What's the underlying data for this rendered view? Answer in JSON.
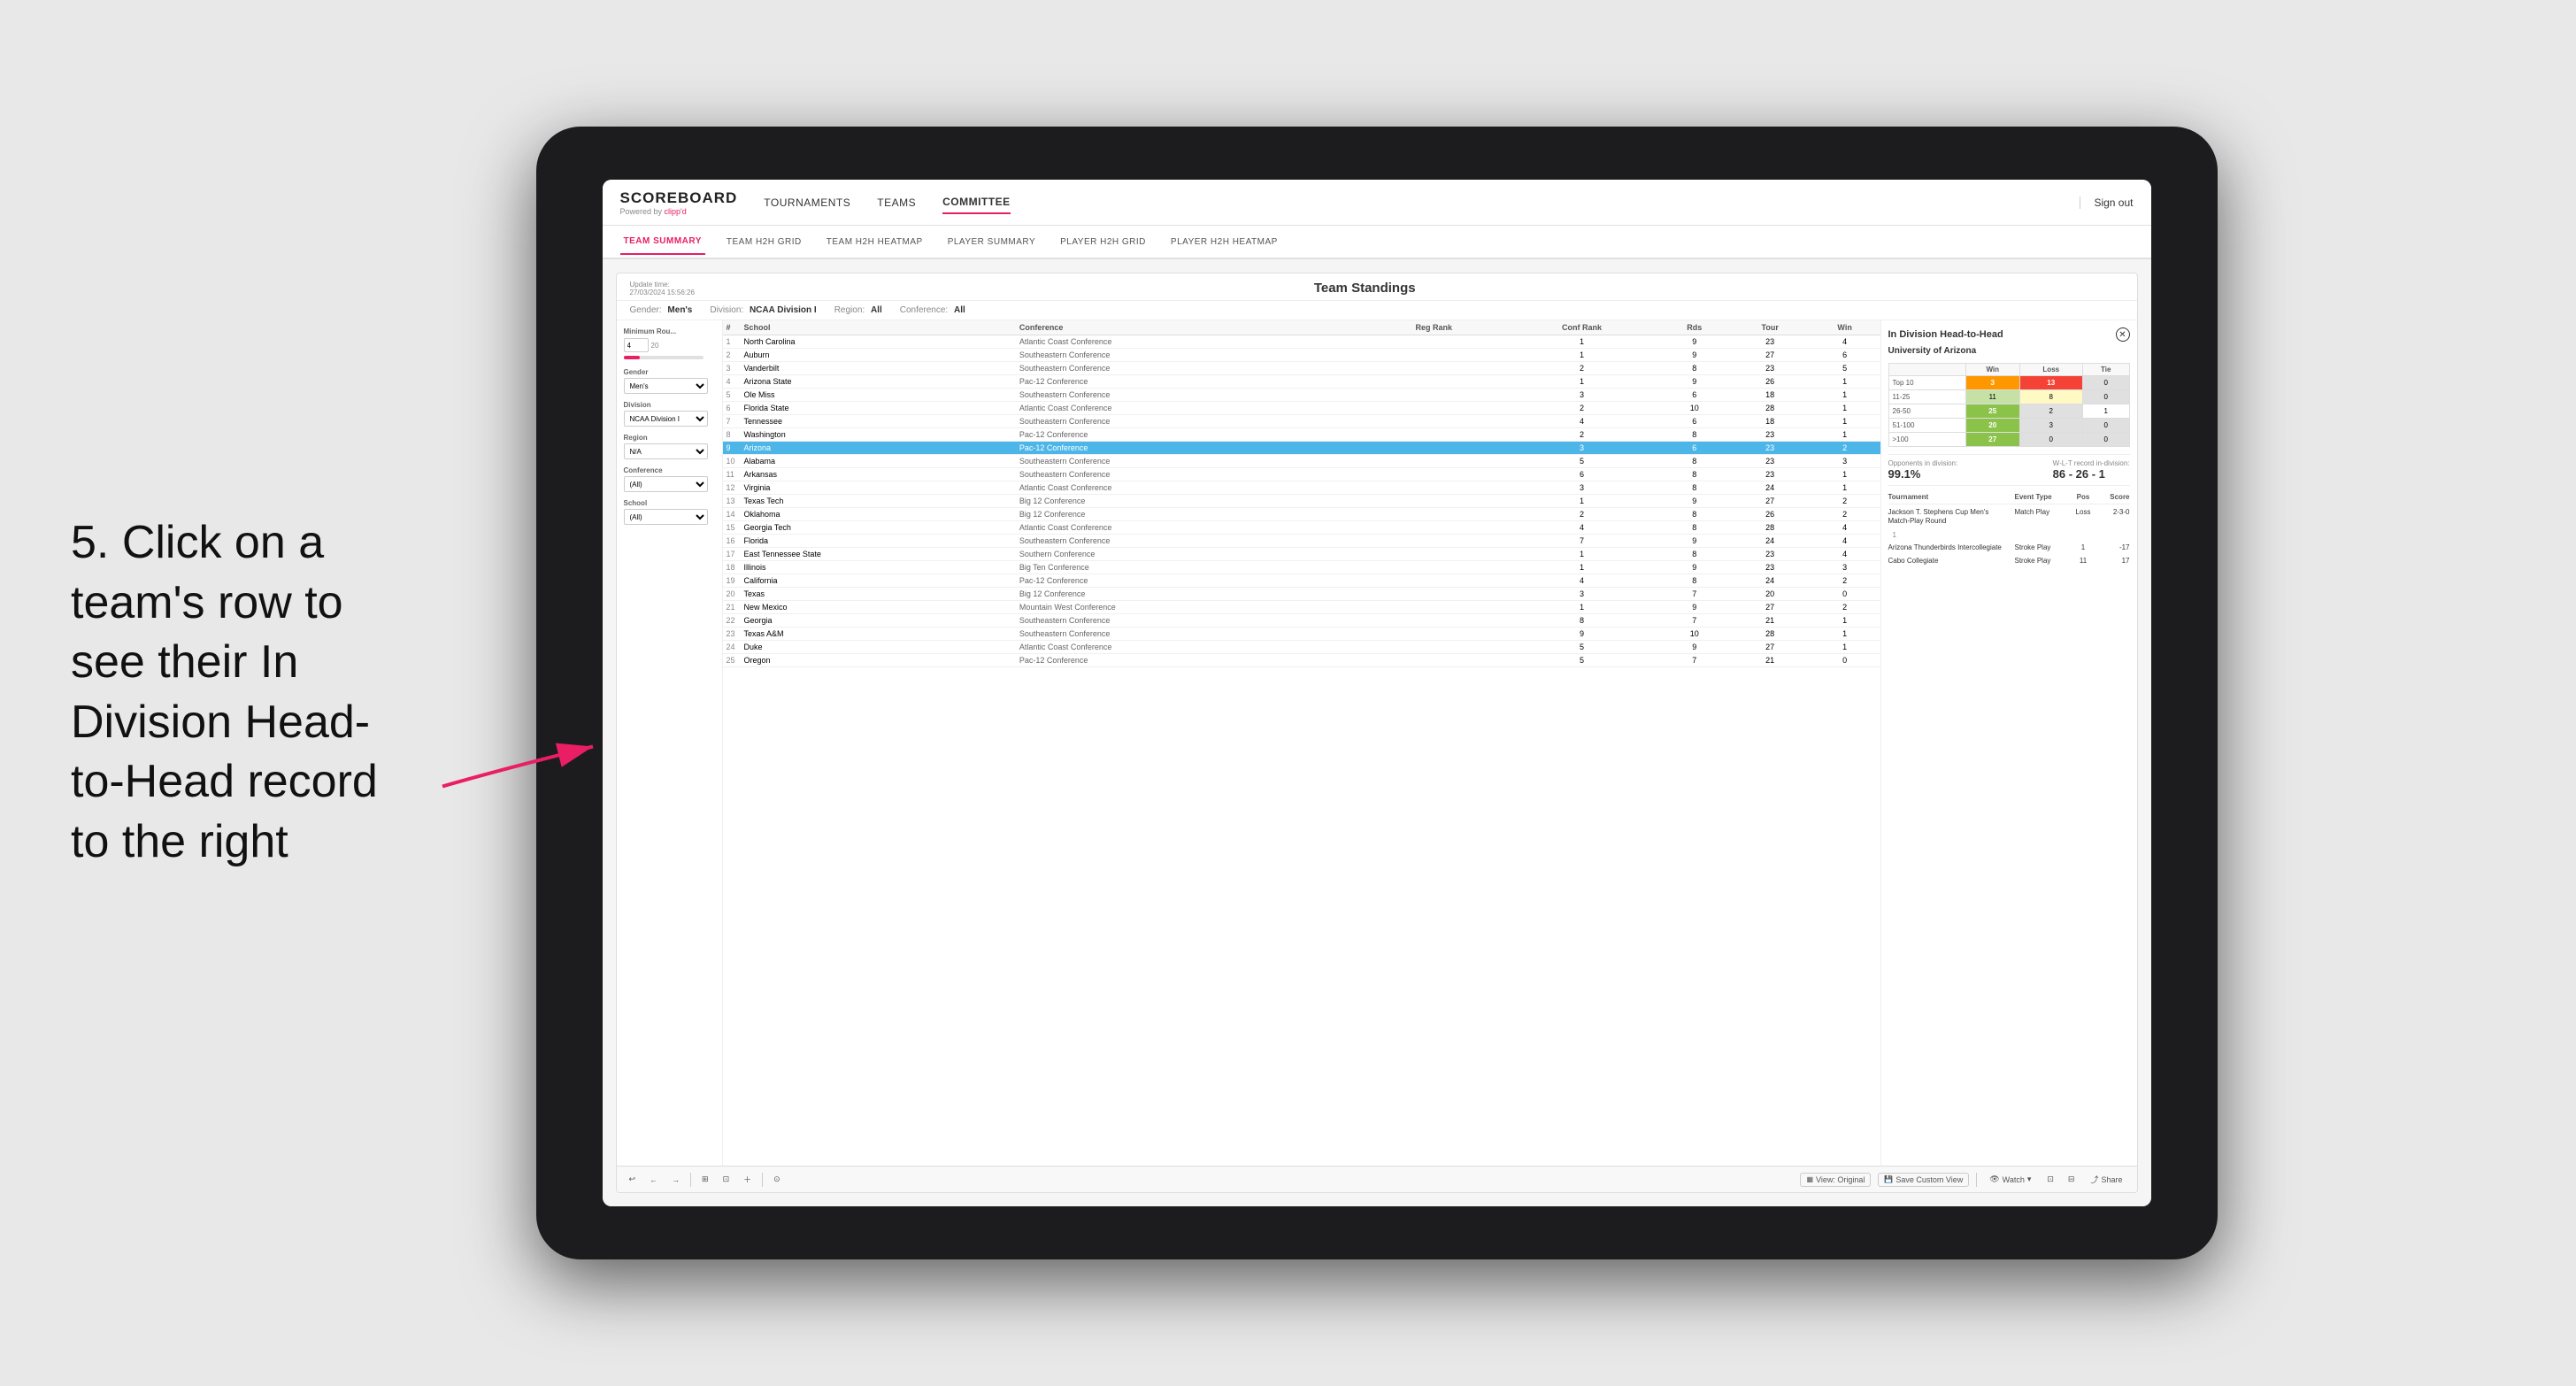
{
  "annotation": {
    "text": "5. Click on a team's row to see their In Division Head-to-Head record to the right"
  },
  "nav": {
    "logo": "SCOREBOARD",
    "logo_sub_pre": "Powered by ",
    "logo_sub_brand": "clipp'd",
    "items": [
      "TOURNAMENTS",
      "TEAMS",
      "COMMITTEE"
    ],
    "active_item": "COMMITTEE",
    "sign_out": "Sign out"
  },
  "sub_nav": {
    "items": [
      "TEAM SUMMARY",
      "TEAM H2H GRID",
      "TEAM H2H HEATMAP",
      "PLAYER SUMMARY",
      "PLAYER H2H GRID",
      "PLAYER H2H HEATMAP"
    ],
    "active_item": "TEAM SUMMARY"
  },
  "panel": {
    "update_label": "Update time:",
    "update_time": "27/03/2024 15:56:26",
    "title": "Team Standings",
    "filters": {
      "gender_label": "Gender:",
      "gender": "Men's",
      "division_label": "Division:",
      "division": "NCAA Division I",
      "region_label": "Region:",
      "region": "All",
      "conference_label": "Conference:",
      "conference": "All"
    }
  },
  "controls": {
    "min_rounds_label": "Minimum Rou...",
    "min_rounds_val": "4",
    "min_rounds_max": "20",
    "gender_label": "Gender",
    "gender_val": "Men's",
    "division_label": "Division",
    "division_val": "NCAA Division I",
    "region_label": "Region",
    "region_val": "N/A",
    "conference_label": "Conference",
    "conference_val": "(All)",
    "school_label": "School",
    "school_val": "(All)"
  },
  "table": {
    "headers": [
      "#",
      "School",
      "Conference",
      "Reg Rank",
      "Conf Rank",
      "Rds",
      "Tour",
      "Win"
    ],
    "rows": [
      {
        "num": 1,
        "school": "North Carolina",
        "conference": "Atlantic Coast Conference",
        "reg": "",
        "conf": 1,
        "rds": 9,
        "tour": 23,
        "win": 4
      },
      {
        "num": 2,
        "school": "Auburn",
        "conference": "Southeastern Conference",
        "reg": "",
        "conf": 1,
        "rds": 9,
        "tour": 27,
        "win": 6
      },
      {
        "num": 3,
        "school": "Vanderbilt",
        "conference": "Southeastern Conference",
        "reg": "",
        "conf": 2,
        "rds": 8,
        "tour": 23,
        "win": 5
      },
      {
        "num": 4,
        "school": "Arizona State",
        "conference": "Pac-12 Conference",
        "reg": "",
        "conf": 1,
        "rds": 9,
        "tour": 26,
        "win": 1
      },
      {
        "num": 5,
        "school": "Ole Miss",
        "conference": "Southeastern Conference",
        "reg": "",
        "conf": 3,
        "rds": 6,
        "tour": 18,
        "win": 1
      },
      {
        "num": 6,
        "school": "Florida State",
        "conference": "Atlantic Coast Conference",
        "reg": "",
        "conf": 2,
        "rds": 10,
        "tour": 28,
        "win": 1
      },
      {
        "num": 7,
        "school": "Tennessee",
        "conference": "Southeastern Conference",
        "reg": "",
        "conf": 4,
        "rds": 6,
        "tour": 18,
        "win": 1
      },
      {
        "num": 8,
        "school": "Washington",
        "conference": "Pac-12 Conference",
        "reg": "",
        "conf": 2,
        "rds": 8,
        "tour": 23,
        "win": 1
      },
      {
        "num": 9,
        "school": "Arizona",
        "conference": "Pac-12 Conference",
        "reg": "",
        "conf": 3,
        "rds": 6,
        "tour": 23,
        "win": 2,
        "highlighted": true
      },
      {
        "num": 10,
        "school": "Alabama",
        "conference": "Southeastern Conference",
        "reg": "",
        "conf": 5,
        "rds": 8,
        "tour": 23,
        "win": 3
      },
      {
        "num": 11,
        "school": "Arkansas",
        "conference": "Southeastern Conference",
        "reg": "",
        "conf": 6,
        "rds": 8,
        "tour": 23,
        "win": 1
      },
      {
        "num": 12,
        "school": "Virginia",
        "conference": "Atlantic Coast Conference",
        "reg": "",
        "conf": 3,
        "rds": 8,
        "tour": 24,
        "win": 1
      },
      {
        "num": 13,
        "school": "Texas Tech",
        "conference": "Big 12 Conference",
        "reg": "",
        "conf": 1,
        "rds": 9,
        "tour": 27,
        "win": 2
      },
      {
        "num": 14,
        "school": "Oklahoma",
        "conference": "Big 12 Conference",
        "reg": "",
        "conf": 2,
        "rds": 8,
        "tour": 26,
        "win": 2
      },
      {
        "num": 15,
        "school": "Georgia Tech",
        "conference": "Atlantic Coast Conference",
        "reg": "",
        "conf": 4,
        "rds": 8,
        "tour": 28,
        "win": 4
      },
      {
        "num": 16,
        "school": "Florida",
        "conference": "Southeastern Conference",
        "reg": "",
        "conf": 7,
        "rds": 9,
        "tour": 24,
        "win": 4
      },
      {
        "num": 17,
        "school": "East Tennessee State",
        "conference": "Southern Conference",
        "reg": "",
        "conf": 1,
        "rds": 8,
        "tour": 23,
        "win": 4
      },
      {
        "num": 18,
        "school": "Illinois",
        "conference": "Big Ten Conference",
        "reg": "",
        "conf": 1,
        "rds": 9,
        "tour": 23,
        "win": 3
      },
      {
        "num": 19,
        "school": "California",
        "conference": "Pac-12 Conference",
        "reg": "",
        "conf": 4,
        "rds": 8,
        "tour": 24,
        "win": 2
      },
      {
        "num": 20,
        "school": "Texas",
        "conference": "Big 12 Conference",
        "reg": "",
        "conf": 3,
        "rds": 7,
        "tour": 20,
        "win": 0
      },
      {
        "num": 21,
        "school": "New Mexico",
        "conference": "Mountain West Conference",
        "reg": "",
        "conf": 1,
        "rds": 9,
        "tour": 27,
        "win": 2
      },
      {
        "num": 22,
        "school": "Georgia",
        "conference": "Southeastern Conference",
        "reg": "",
        "conf": 8,
        "rds": 7,
        "tour": 21,
        "win": 1
      },
      {
        "num": 23,
        "school": "Texas A&M",
        "conference": "Southeastern Conference",
        "reg": "",
        "conf": 9,
        "rds": 10,
        "tour": 28,
        "win": 1
      },
      {
        "num": 24,
        "school": "Duke",
        "conference": "Atlantic Coast Conference",
        "reg": "",
        "conf": 5,
        "rds": 9,
        "tour": 27,
        "win": 1
      },
      {
        "num": 25,
        "school": "Oregon",
        "conference": "Pac-12 Conference",
        "reg": "",
        "conf": 5,
        "rds": 7,
        "tour": 21,
        "win": 0
      }
    ]
  },
  "h2h": {
    "title": "In Division Head-to-Head",
    "school": "University of Arizona",
    "table_headers": [
      "",
      "Win",
      "Loss",
      "Tie"
    ],
    "rows": [
      {
        "label": "Top 10",
        "win": 3,
        "loss": 13,
        "tie": 0,
        "win_color": "orange",
        "loss_color": "red"
      },
      {
        "label": "11-25",
        "win": 11,
        "loss": 8,
        "tie": 0,
        "win_color": "light-green",
        "loss_color": "yellow"
      },
      {
        "label": "26-50",
        "win": 25,
        "loss": 2,
        "tie": 1,
        "win_color": "green",
        "loss_color": "gray"
      },
      {
        "label": "51-100",
        "win": 20,
        "loss": 3,
        "tie": 0,
        "win_color": "green",
        "loss_color": "gray"
      },
      {
        "label": ">100",
        "win": 27,
        "loss": 0,
        "tie": 0,
        "win_color": "green",
        "loss_color": "gray"
      }
    ],
    "opponents_label": "Opponents in division:",
    "opponents_value": "99.1%",
    "wlt_label": "W-L-T record in-division:",
    "wlt_value": "86 - 26 - 1",
    "tournaments_label": "Tournament",
    "event_type_label": "Event Type",
    "pos_label": "Pos",
    "score_label": "Score",
    "tournament_rows": [
      {
        "name": "Jackson T. Stephens Cup Men's Match-Play Round",
        "type": "Match Play",
        "result": "Loss",
        "score": "2-3-0",
        "pos": 1
      },
      {
        "name": "Arizona Thunderbirds Intercollegiate",
        "type": "Stroke Play",
        "pos": 1,
        "score": "-17"
      },
      {
        "name": "Cabo Collegiate",
        "type": "Stroke Play",
        "pos": 11,
        "score": "17"
      }
    ]
  },
  "toolbar": {
    "undo": "↩",
    "redo_left": "←",
    "redo_right": "→",
    "copy": "⊞",
    "view_original": "View: Original",
    "save_custom": "Save Custom View",
    "watch": "Watch",
    "icon1": "⊡",
    "icon2": "⊟",
    "share": "Share"
  }
}
